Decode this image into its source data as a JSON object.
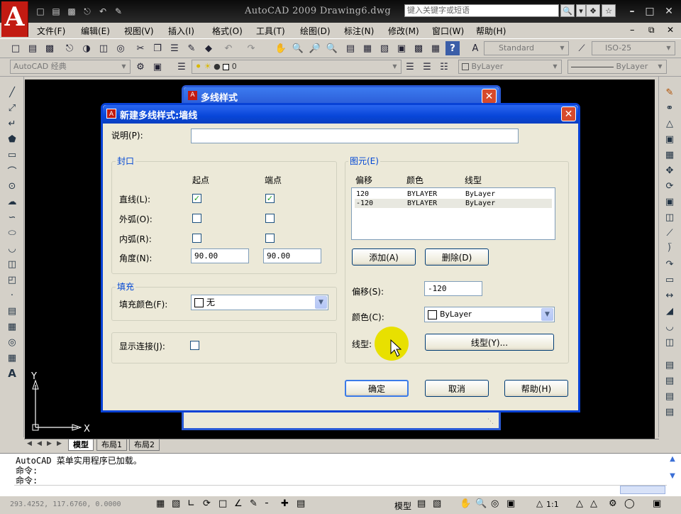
{
  "window": {
    "app_logo": "A",
    "title": "AutoCAD 2009  Drawing6.dwg",
    "search_placeholder": "键入关键字或短语"
  },
  "menu": [
    "文件(F)",
    "编辑(E)",
    "视图(V)",
    "插入(I)",
    "格式(O)",
    "工具(T)",
    "绘图(D)",
    "标注(N)",
    "修改(M)",
    "窗口(W)",
    "帮助(H)"
  ],
  "toolbar": {
    "text_style": "Standard",
    "dim_style": "ISO-25",
    "workspace": "AutoCAD 经典",
    "layer": "0",
    "color": "ByLayer",
    "linetype": "ByLayer"
  },
  "layout_tabs": [
    "模型",
    "布局1",
    "布局2"
  ],
  "ucs": {
    "y": "Y",
    "x": "X"
  },
  "command": {
    "lines": [
      "AutoCAD 菜单实用程序已加载。",
      "命令:",
      "命令:"
    ]
  },
  "status": {
    "coords": "293.4252, 117.6760, 0.0000",
    "model": "模型",
    "scale": "1:1"
  },
  "back_dialog": {
    "title": "多线样式"
  },
  "dialog": {
    "title": "新建多线样式:墙线",
    "description_label": "说明(P):",
    "description_value": "",
    "caps": {
      "group": "封口",
      "col_start": "起点",
      "col_end": "端点",
      "line_label": "直线(L):",
      "outer_arc_label": "外弧(O):",
      "inner_arc_label": "内弧(R):",
      "angle_label": "角度(N):",
      "angle_start": "90.00",
      "angle_end": "90.00"
    },
    "fill": {
      "group": "填充",
      "label": "填充颜色(F):",
      "value": "无"
    },
    "joints_label": "显示连接(J):",
    "elements": {
      "group": "图元(E)",
      "headers": [
        "偏移",
        "颜色",
        "线型"
      ],
      "rows": [
        [
          "120",
          "BYLAYER",
          "ByLayer"
        ],
        [
          "-120",
          "BYLAYER",
          "ByLayer"
        ]
      ],
      "add_button": "添加(A)",
      "delete_button": "删除(D)",
      "offset_label": "偏移(S):",
      "offset_value": "-120",
      "color_label": "颜色(C):",
      "color_value": "ByLayer",
      "linetype_label": "线型:",
      "linetype_button": "线型(Y)..."
    },
    "ok": "确定",
    "cancel": "取消",
    "help": "帮助(H)"
  }
}
